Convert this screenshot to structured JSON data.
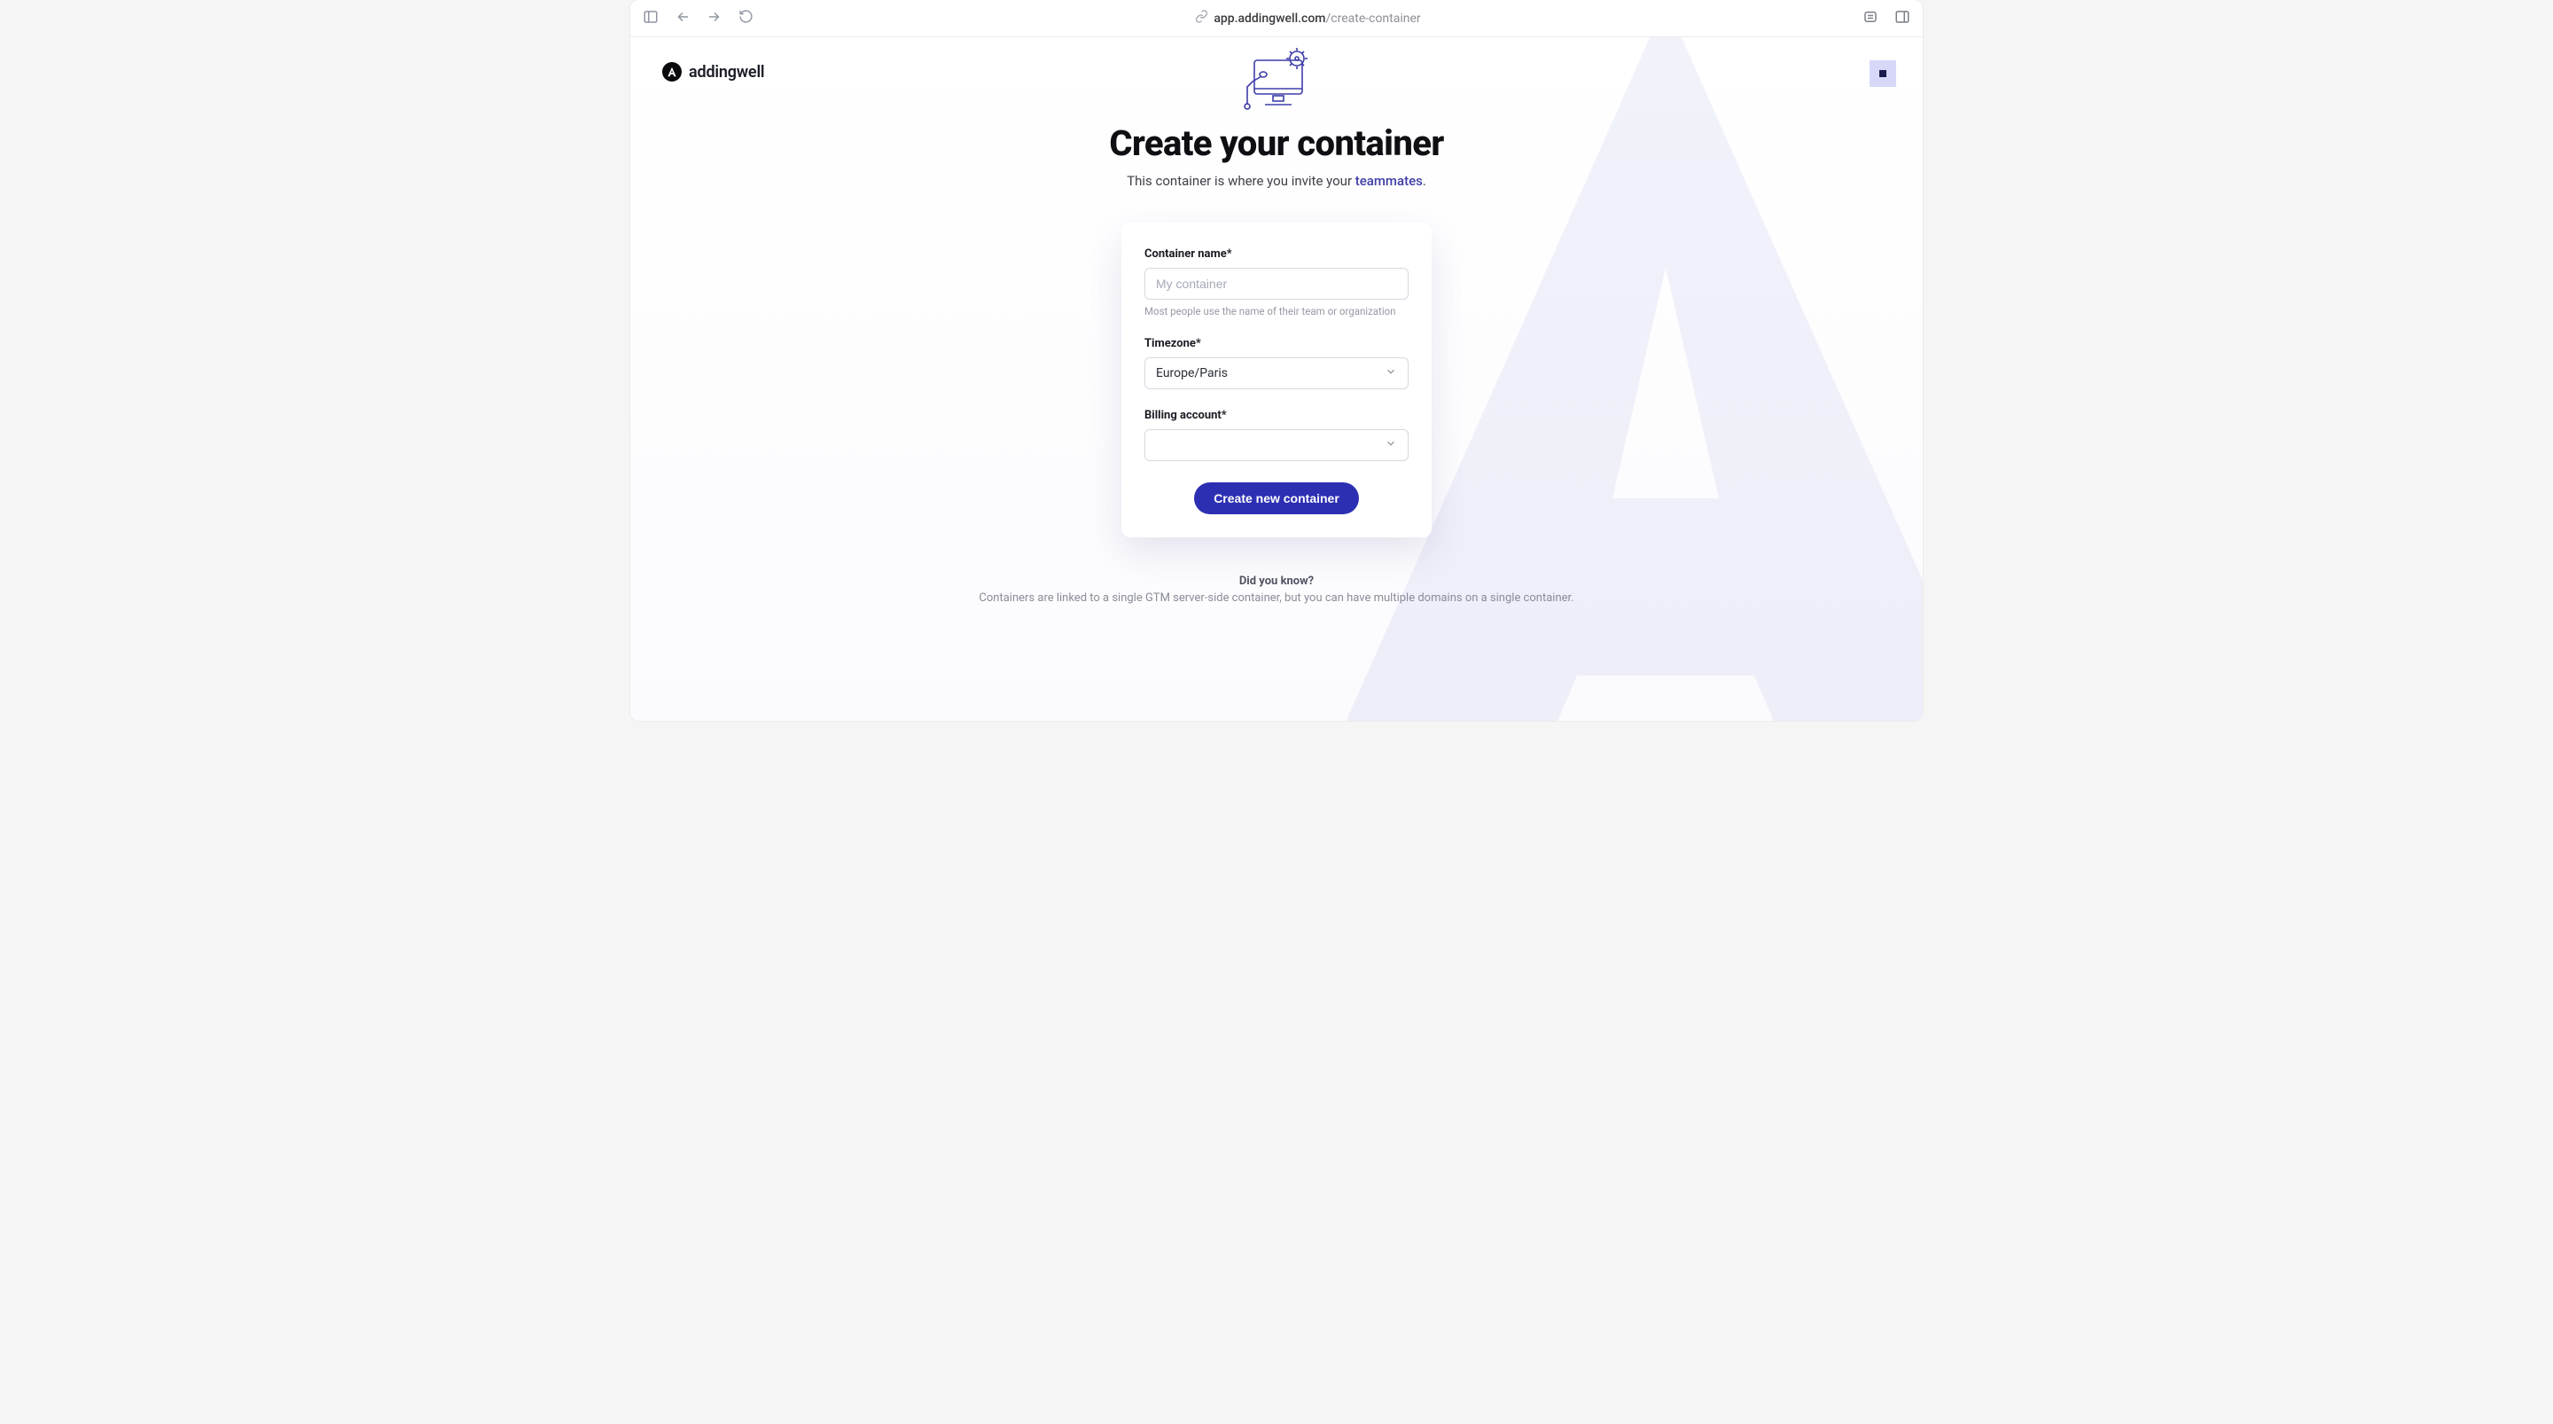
{
  "browser": {
    "url_host": "app.addingwell.com",
    "url_path": "/create-container"
  },
  "brand": {
    "name": "addingwell",
    "mark_glyph": "A"
  },
  "header": {
    "title": "Create your container",
    "subtext_prefix": "This container is where you invite your ",
    "subtext_link": "teammates",
    "subtext_suffix": "."
  },
  "form": {
    "container_name": {
      "label": "Container name*",
      "placeholder": "My container",
      "value": "",
      "hint": "Most people use the name of their team or organization"
    },
    "timezone": {
      "label": "Timezone*",
      "value": "Europe/Paris"
    },
    "billing_account": {
      "label": "Billing account*",
      "value": ""
    },
    "submit_label": "Create new container"
  },
  "footer": {
    "lead": "Did you know?",
    "body": "Containers are linked to a single GTM server-side container, but you can have multiple domains on a single container."
  }
}
